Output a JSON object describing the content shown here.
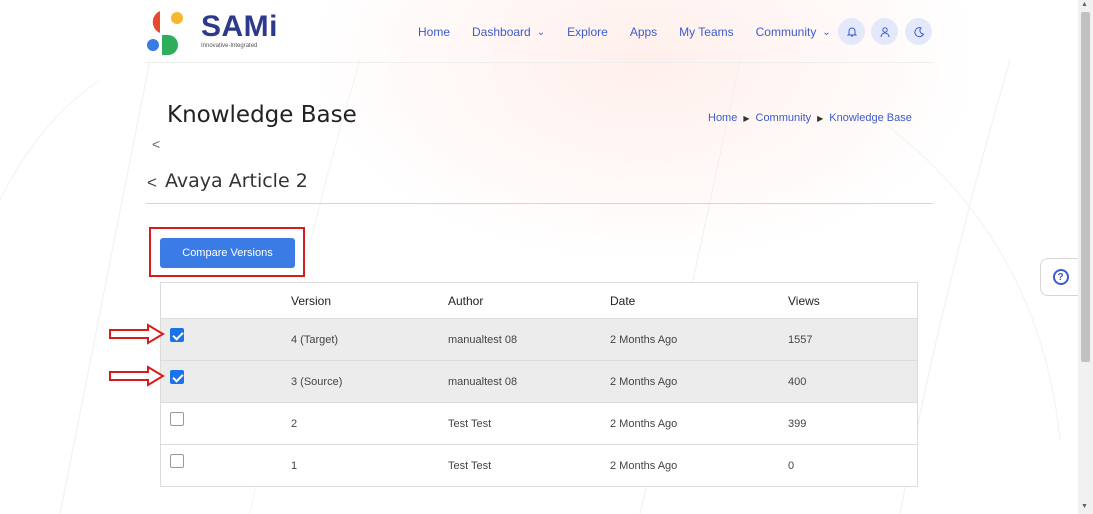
{
  "brand": {
    "name": "SAMi",
    "tagline": "Innovative-Integrated"
  },
  "nav": {
    "items": [
      {
        "label": "Home"
      },
      {
        "label": "Dashboard"
      },
      {
        "label": "Explore"
      },
      {
        "label": "Apps"
      },
      {
        "label": "My Teams"
      },
      {
        "label": "Community"
      }
    ],
    "icons": [
      "bell-icon",
      "user-icon",
      "moon-icon"
    ]
  },
  "page": {
    "title": "Knowledge Base",
    "back_glyph": "<",
    "breadcrumb": [
      "Home",
      "Community",
      "Knowledge Base"
    ]
  },
  "article": {
    "title": "Avaya Article 2",
    "back_glyph": "<"
  },
  "compare": {
    "label": "Compare Versions"
  },
  "table": {
    "headers": [
      "Version",
      "Author",
      "Date",
      "Views"
    ],
    "rows": [
      {
        "version": "4 (Target)",
        "author": "manualtest 08",
        "date": "2 Months Ago",
        "views": "1557",
        "checked": true
      },
      {
        "version": "3 (Source)",
        "author": "manualtest 08",
        "date": "2 Months Ago",
        "views": "400",
        "checked": true
      },
      {
        "version": "2",
        "author": "Test Test",
        "date": "2 Months Ago",
        "views": "399",
        "checked": false
      },
      {
        "version": "1",
        "author": "Test Test",
        "date": "2 Months Ago",
        "views": "0",
        "checked": false
      }
    ]
  },
  "help": {
    "icon": "help-icon",
    "glyph": "?"
  },
  "colors": {
    "accent": "#3b7be6",
    "highlight": "#d81c1c",
    "brand_text": "#2d3a8c",
    "link": "#3c5bcf"
  }
}
